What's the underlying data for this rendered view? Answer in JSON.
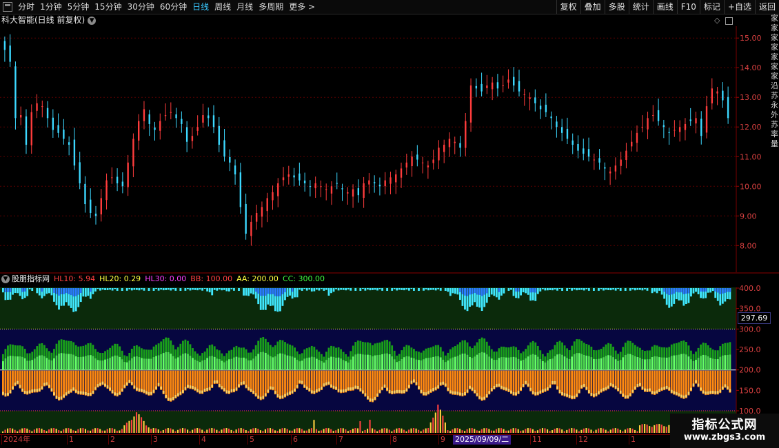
{
  "toolbar": {
    "periods": [
      "分时",
      "1分钟",
      "5分钟",
      "15分钟",
      "30分钟",
      "60分钟",
      "日线",
      "周线",
      "月线",
      "多周期",
      "更多 >"
    ],
    "active_period": "日线",
    "right_buttons": [
      "复权",
      "叠加",
      "多股",
      "统计",
      "画线",
      "F10",
      "标记",
      "+自选",
      "返回"
    ]
  },
  "price_panel": {
    "title": "科大智能(日线 前复权)",
    "y_ticks": [
      "15.00",
      "14.00",
      "13.00",
      "12.00",
      "11.00",
      "10.00",
      "9.00",
      "8.00"
    ],
    "y_values": [
      15,
      14,
      13,
      12,
      11,
      10,
      9,
      8
    ],
    "ylim": [
      7.1,
      15.4
    ]
  },
  "indicator_panel": {
    "name": "股朋指标网",
    "hl10": "HL10: 5.94",
    "hl20": "HL20: 0.29",
    "hl30": "HL30: 0.00",
    "bb": "BB: 100.00",
    "aa": "AA: 200.00",
    "cc": "CC: 300.00",
    "y_ticks": [
      "400.0",
      "350.0",
      "300.0",
      "250.0",
      "200.0",
      "150.0",
      "100.0"
    ],
    "y_values": [
      400,
      350,
      300,
      250,
      200,
      150,
      100
    ],
    "cursor_value": "297.69"
  },
  "date_axis": {
    "ticks": [
      "2024年",
      "1",
      "2",
      "3",
      "4",
      "5",
      "6",
      "7",
      "8",
      "9",
      "11",
      "12",
      "1"
    ],
    "selected": "2025/09/09/二"
  },
  "right_strip": [
    "家",
    "家",
    "家",
    "家",
    "家",
    "家",
    "家",
    "沿",
    "苏",
    "永",
    "外",
    "苏",
    "率",
    "量"
  ],
  "watermark": {
    "main": "指标公式网",
    "sub": "www.zbgs3.com"
  },
  "colors": {
    "up": "#ff3c3c",
    "down": "#3cd8ff",
    "grid": "#5a0000"
  },
  "chart_data": {
    "type": "candlestick",
    "series": [
      {
        "values": [
          14.6,
          14.2,
          12.3,
          12.4,
          11.4,
          12.5,
          12.8,
          12.7,
          12.3,
          11.9,
          11.8,
          11.6,
          11.4,
          10.7,
          10.1,
          9.4,
          9.1,
          9.0,
          9.6,
          10.2,
          10.3,
          10.1,
          10.0,
          10.8,
          11.6,
          12.2,
          12.6,
          12.1,
          11.9,
          12.2,
          12.4,
          12.5,
          12.3,
          12.1,
          11.5,
          11.7,
          12.0,
          12.4,
          12.3,
          12.0,
          11.4,
          11.0,
          10.8,
          10.4,
          9.3,
          8.4,
          8.8,
          9.1,
          9.3,
          9.6,
          9.8,
          10.1,
          10.3,
          10.4,
          10.3,
          10.2,
          10.1,
          10.0,
          10.1,
          10.0,
          9.9,
          10.0,
          10.1,
          9.9,
          9.8,
          9.9,
          9.7,
          10.1,
          10.2,
          10.1,
          10.0,
          10.2,
          10.3,
          10.4,
          10.6,
          10.8,
          11.0,
          10.9,
          10.8,
          10.7,
          10.9,
          11.3,
          11.4,
          11.6,
          11.5,
          11.3,
          12.2,
          13.4,
          13.3,
          13.2,
          13.4,
          13.5,
          13.3,
          13.4,
          13.6,
          13.4,
          13.2,
          13.1,
          13.0,
          12.8,
          12.6,
          12.5,
          12.3,
          12.0,
          11.8,
          11.6,
          11.4,
          11.2,
          11.1,
          11.0,
          10.9,
          10.8,
          10.6,
          10.5,
          10.7,
          10.9,
          11.2,
          11.5,
          11.8,
          12.0,
          12.3,
          12.4,
          12.2,
          12.0,
          11.8,
          11.9,
          12.0,
          12.1,
          12.2,
          12.3,
          11.7,
          12.7,
          13.3,
          13.2,
          12.9,
          12.3
        ]
      }
    ],
    "ylim": [
      7.1,
      15.4
    ],
    "y_ticks": [
      15,
      14,
      13,
      12,
      11,
      10,
      9,
      8
    ]
  }
}
